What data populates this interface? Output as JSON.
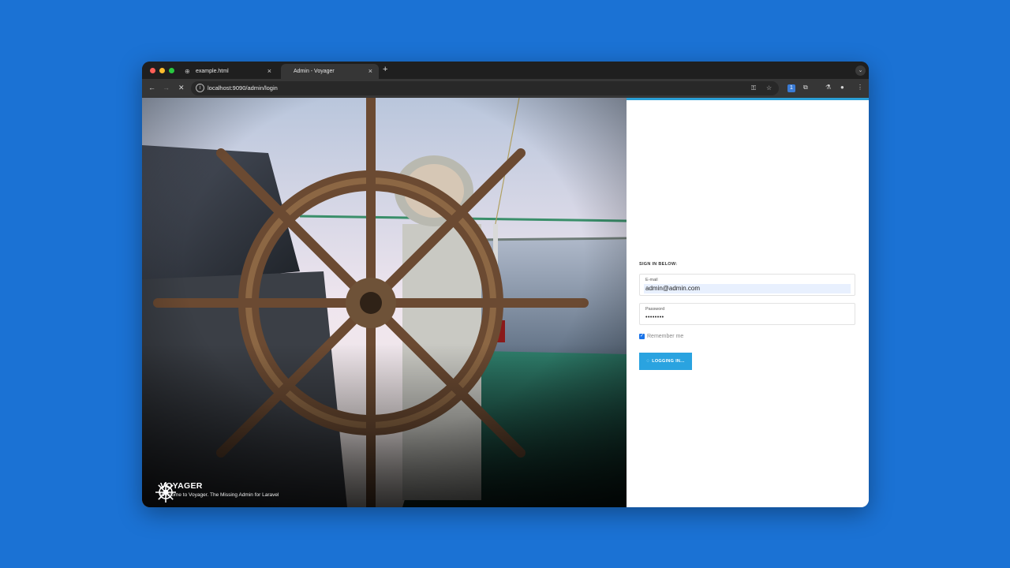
{
  "browser": {
    "tabs": [
      {
        "label": "example.html",
        "icon": "globe-icon"
      },
      {
        "label": "Admin - Voyager",
        "icon": "none"
      }
    ],
    "url": "localhost:9090/admin/login"
  },
  "brand": {
    "title": "VOYAGER",
    "subtitle": "Welcome to Voyager. The Missing Admin for Laravel"
  },
  "login": {
    "heading": "SIGN IN BELOW:",
    "email_label": "E-mail",
    "email_value": "admin@admin.com",
    "password_label": "Password",
    "password_value": "••••••••",
    "remember_label": "Remember me",
    "remember_checked": true,
    "button_label": "LOGGING IN...",
    "accent_color": "#2aa3e0"
  },
  "desktop_background": "#1b72d4"
}
